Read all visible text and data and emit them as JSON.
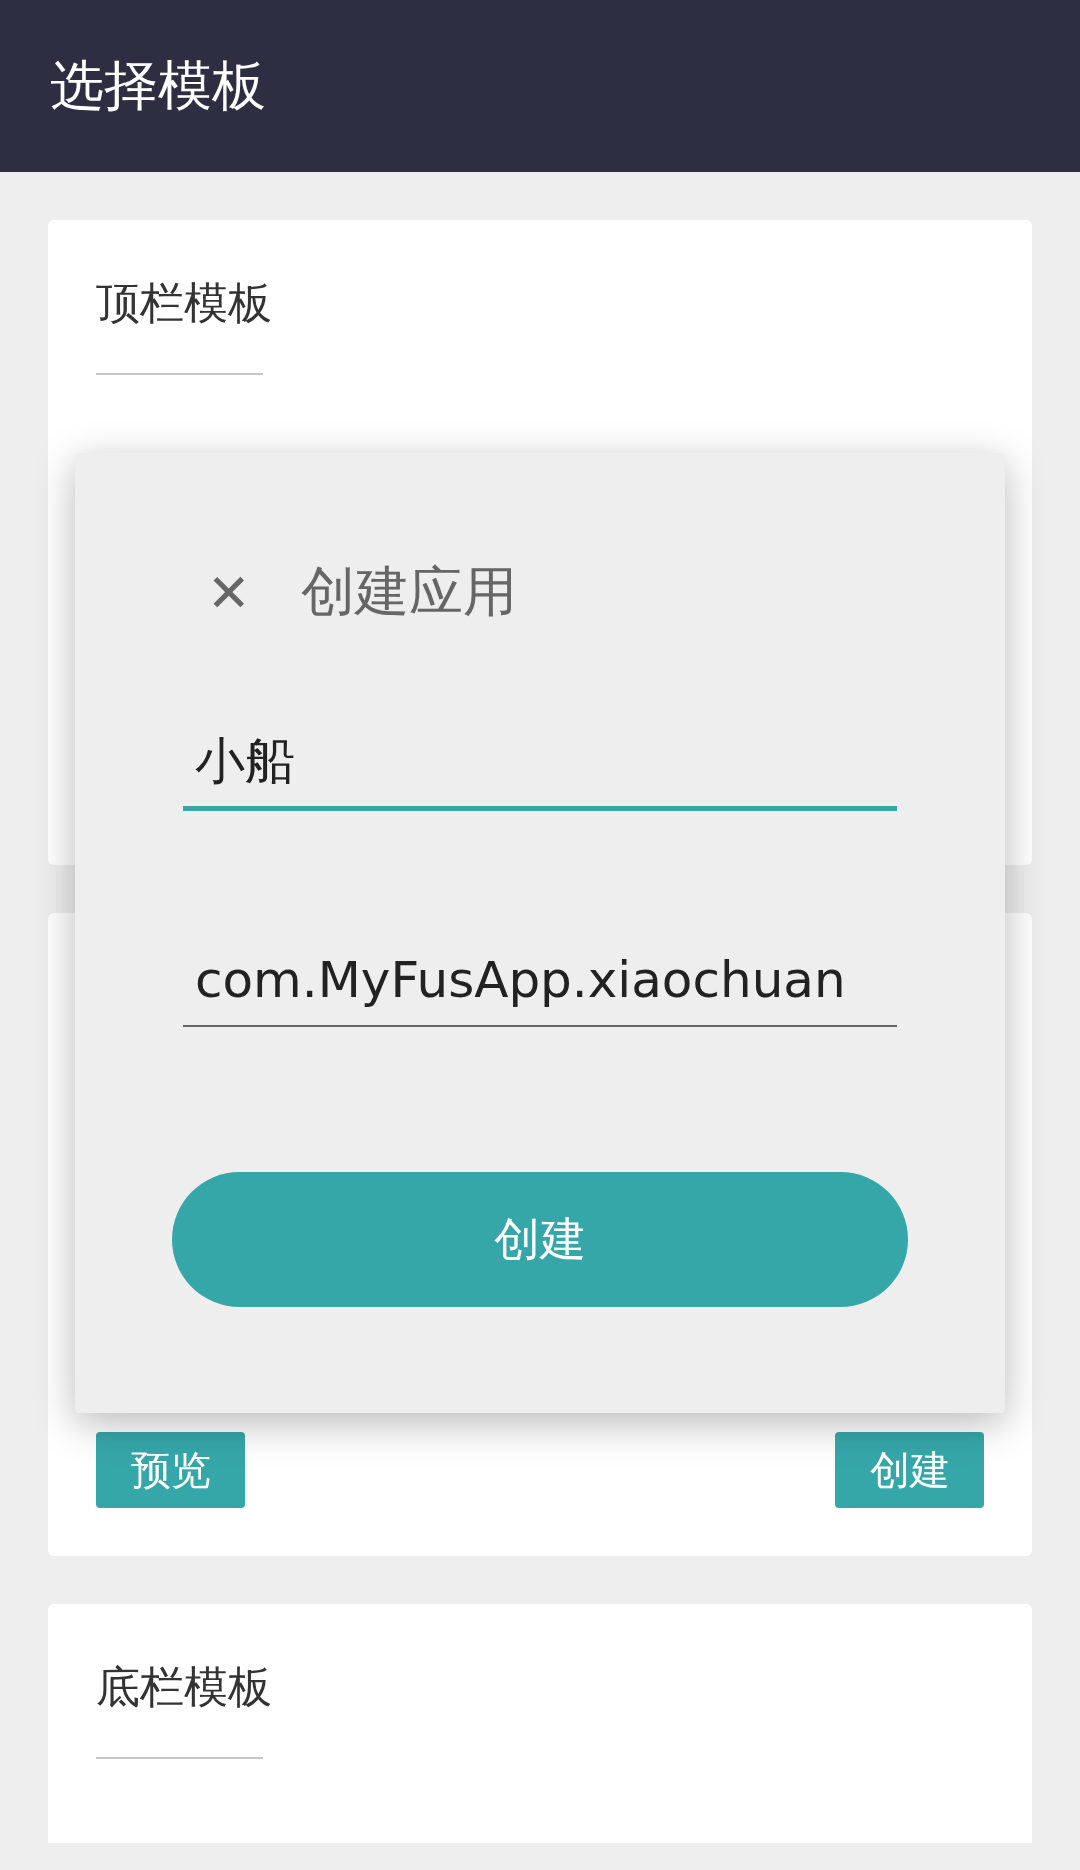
{
  "app_bar": {
    "title": "选择模板"
  },
  "cards": [
    {
      "title": "顶栏模板"
    },
    {
      "buttons": [
        {
          "label": "预览"
        },
        {
          "label": "创建"
        }
      ]
    },
    {
      "title": "底栏模板"
    }
  ],
  "dialog": {
    "title": "创建应用",
    "close": "✕",
    "fields": [
      {
        "value": "小船",
        "focused": true
      },
      {
        "value": "com.MyFusApp.xiaochuan",
        "focused": false
      }
    ],
    "button": "创建"
  }
}
